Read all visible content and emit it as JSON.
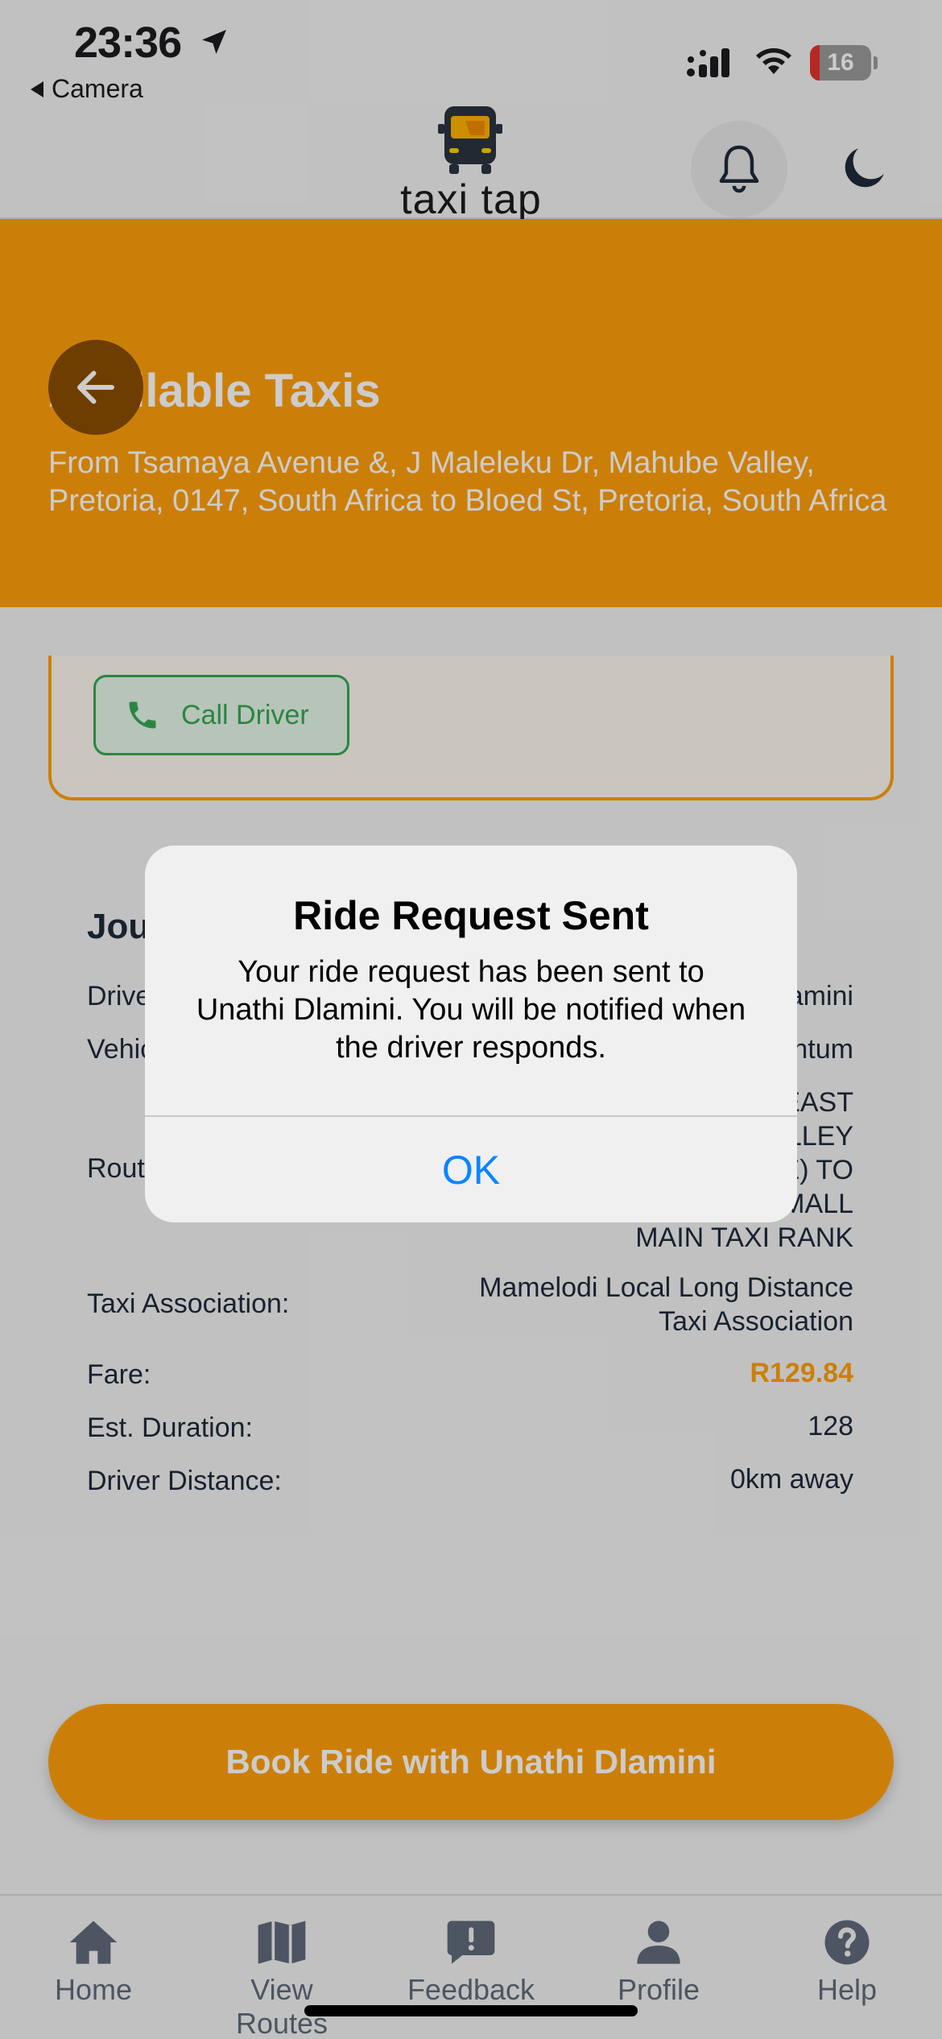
{
  "status_bar": {
    "time": "23:36",
    "back_app": "Camera",
    "battery": "16",
    "battery_level": 0.16,
    "battery_color": "#e5322d"
  },
  "header": {
    "logo_text": "taxi tap",
    "bell_icon": "bell-icon",
    "theme_icon": "moon-icon"
  },
  "banner": {
    "title": "Available Taxis",
    "subtitle": "From Tsamaya Avenue &, J Maleleku Dr, Mahube Valley, Pretoria, 0147, South Africa to Bloed St, Pretoria, South Africa",
    "accent_color": "#ff9f0a"
  },
  "taxi_card": {
    "call_label": "Call Driver",
    "call_color": "#34a853"
  },
  "journey": {
    "title": "Journey Details",
    "driver_label": "Driver:",
    "driver_value": "Unathi Dlamini",
    "vehicle_label": "Vehicle:",
    "vehicle_value": "Toyota Quantum",
    "route_label": "Route:",
    "route_value": "MAMELODI EAST MAHUBE VALLEY (VARIATED ROUTE) TO BLOED STREET MALL MAIN TAXI RANK",
    "association_label": "Taxi Association:",
    "association_value": "Mamelodi Local Long Distance Taxi Association",
    "fare_label": "Fare:",
    "fare_value": "R129.84",
    "duration_label": "Est. Duration:",
    "duration_value": "128",
    "distance_label": "Driver Distance:",
    "distance_value": "0km away"
  },
  "book_button": "Book Ride with Unathi Dlamini",
  "tabs": [
    {
      "label": "Home",
      "icon": "home-icon"
    },
    {
      "label": "View Routes",
      "icon": "map-icon"
    },
    {
      "label": "Feedback",
      "icon": "feedback-icon"
    },
    {
      "label": "Profile",
      "icon": "profile-icon"
    },
    {
      "label": "Help",
      "icon": "help-icon"
    }
  ],
  "alert": {
    "title": "Ride Request Sent",
    "message": "Your ride request has been sent to Unathi Dlamini. You will be notified when the driver responds.",
    "ok_label": "OK",
    "link_color": "#0a84ff"
  }
}
